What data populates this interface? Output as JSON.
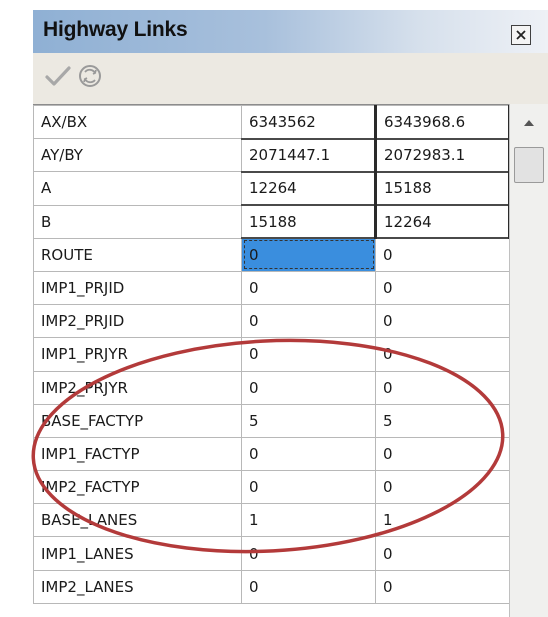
{
  "window": {
    "title": "Highway Links"
  },
  "toolbar": {
    "icons": [
      "checkmark-icon",
      "refresh-icon"
    ]
  },
  "grid": {
    "rows": [
      {
        "name": "AX/BX",
        "a": "6343562",
        "b": "6343968.6",
        "readonly": true
      },
      {
        "name": "AY/BY",
        "a": "2071447.1",
        "b": "2072983.1",
        "readonly": true
      },
      {
        "name": "A",
        "a": "12264",
        "b": "15188",
        "readonly": true
      },
      {
        "name": "B",
        "a": "15188",
        "b": "12264",
        "readonly": true
      },
      {
        "name": "ROUTE",
        "a": "0",
        "b": "0",
        "readonly": false
      },
      {
        "name": "IMP1_PRJID",
        "a": "0",
        "b": "0",
        "readonly": false
      },
      {
        "name": "IMP2_PRJID",
        "a": "0",
        "b": "0",
        "readonly": false
      },
      {
        "name": "IMP1_PRJYR",
        "a": "0",
        "b": "0",
        "readonly": false
      },
      {
        "name": "IMP2_PRJYR",
        "a": "0",
        "b": "0",
        "readonly": false
      },
      {
        "name": "BASE_FACTYP",
        "a": "5",
        "b": "5",
        "readonly": false
      },
      {
        "name": "IMP1_FACTYP",
        "a": "0",
        "b": "0",
        "readonly": false
      },
      {
        "name": "IMP2_FACTYP",
        "a": "0",
        "b": "0",
        "readonly": false
      },
      {
        "name": "BASE_LANES",
        "a": "1",
        "b": "1",
        "readonly": false
      },
      {
        "name": "IMP1_LANES",
        "a": "0",
        "b": "0",
        "readonly": false
      },
      {
        "name": "IMP2_LANES",
        "a": "0",
        "b": "0",
        "readonly": false
      }
    ],
    "selected": {
      "row": 4,
      "column": "a"
    }
  },
  "annotation": {
    "shape": "ellipse",
    "color": "#b33a3a"
  }
}
